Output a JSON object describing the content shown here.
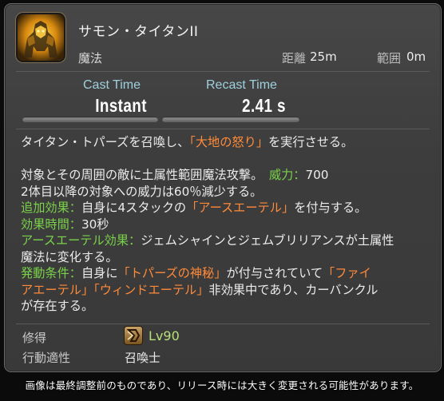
{
  "skill": {
    "name": "サモン・タイタンII",
    "type": "魔法",
    "icon": "summon-titan-icon",
    "range_label": "距離",
    "range_value": "25m",
    "radius_label": "範囲",
    "radius_value": "0m"
  },
  "timing": {
    "cast_label": "Cast Time",
    "cast_value": "Instant",
    "recast_label": "Recast Time",
    "recast_value": "2.41 s"
  },
  "description": {
    "line1_a": "タイタン・トパーズを召喚し、",
    "line1_b": "「大地の怒り」",
    "line1_c": "を実行させる。",
    "line2_a": "対象とその周囲の敵に土属性範囲魔法攻撃。　",
    "line2_b": "威力：",
    "line2_c": "700",
    "line3": "2体目以降の対象への威力は60％減少する。",
    "line4_a": "追加効果：",
    "line4_b": "自身に4スタックの",
    "line4_c": "「アースエーテル」",
    "line4_d": "を付与する。",
    "line5_a": "効果時間：",
    "line5_b": "30秒",
    "line6_a": "アースエーテル効果：",
    "line6_b": "ジェムシャインとジェムブリリアンスが土属性",
    "line7": "魔法に変化する。",
    "line8_a": "発動条件：",
    "line8_b": "自身に",
    "line8_c": "「トパーズの神秘」",
    "line8_d": "が付与されていて",
    "line8_e": "「ファイ",
    "line9_a": "アエーテル」「ウィンドエーテル」",
    "line9_b": "非効果中であり、カーバンクル",
    "line10": "が存在する。"
  },
  "footer": {
    "acquired_label": "修得",
    "job_icon": "summoner-job-icon",
    "level": "Lv90",
    "affinity_label": "行動適性",
    "affinity_value": "召喚士"
  },
  "notice": "画像は最終調整前のものであり、リリース時には大きく変更される可能性があります。",
  "colors": {
    "highlight": "#ff8a3a",
    "label_green": "#7ad24a",
    "timing_label": "#9fd0de",
    "level_green": "#b8e07a"
  }
}
